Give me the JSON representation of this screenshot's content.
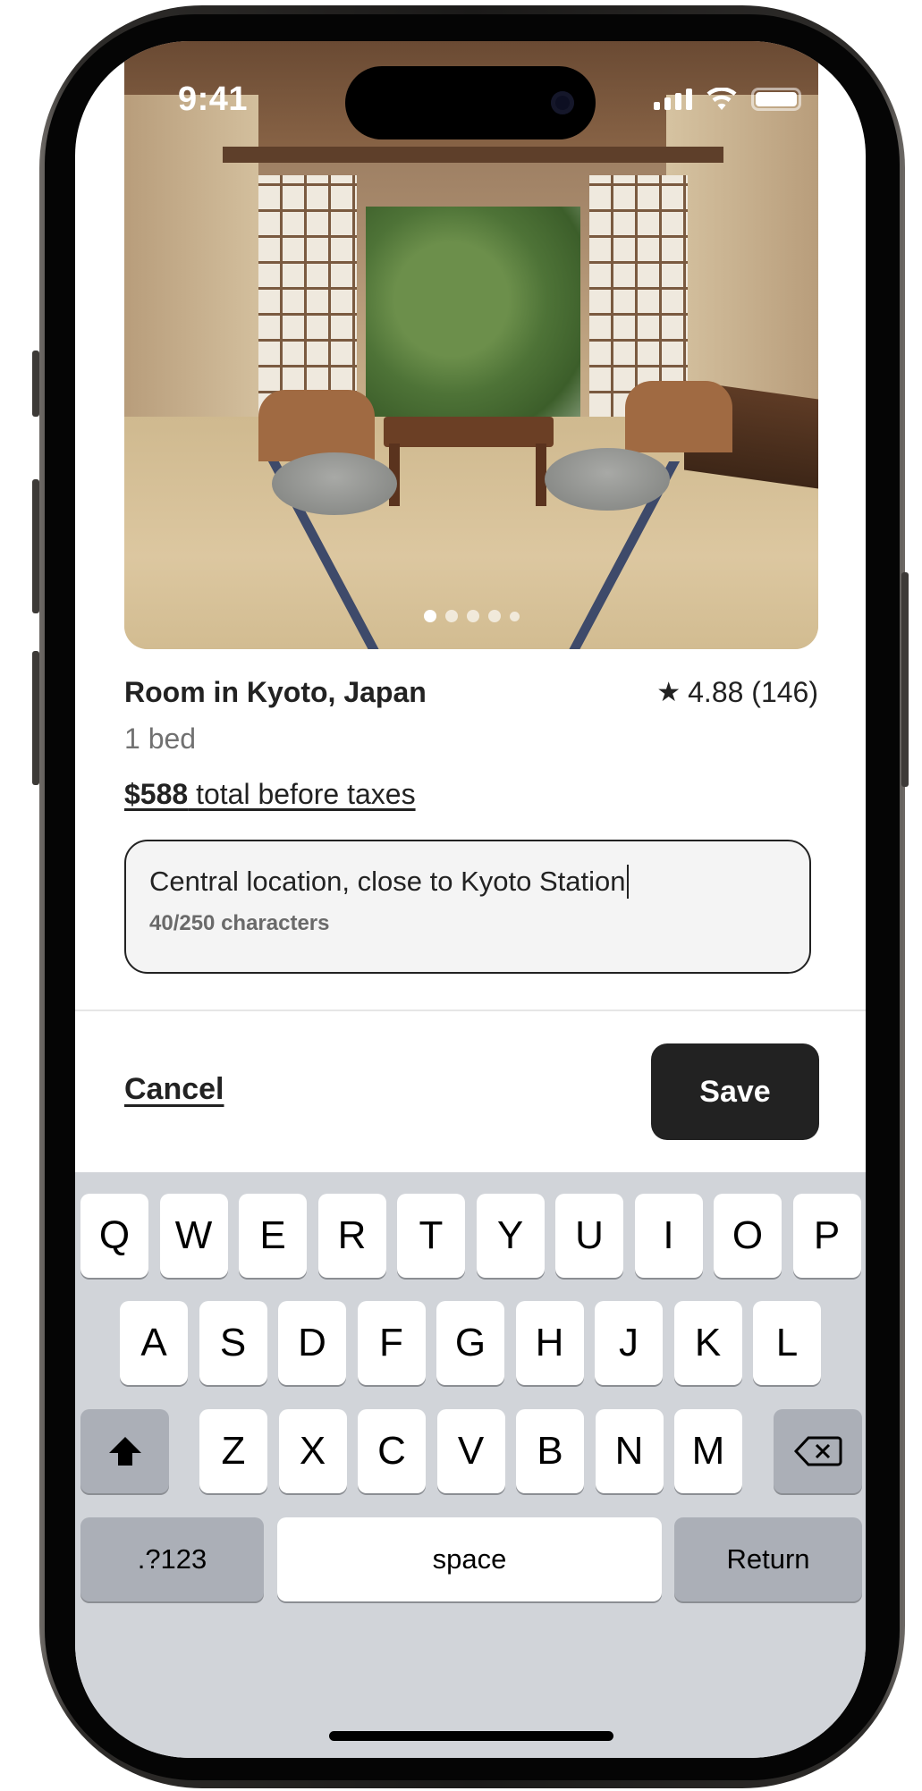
{
  "status_bar": {
    "time": "9:41"
  },
  "listing": {
    "title": "Room in Kyoto, Japan",
    "rating": "4.88 (146)",
    "beds": "1 bed",
    "price_amount": "$588",
    "price_suffix": " total before taxes",
    "photo_count": 5,
    "photo_active_index": 0
  },
  "note": {
    "value": "Central location, close to Kyoto Station",
    "counter": "40/250 characters"
  },
  "actions": {
    "cancel_label": "Cancel",
    "save_label": "Save"
  },
  "keyboard": {
    "row1": [
      "Q",
      "W",
      "E",
      "R",
      "T",
      "Y",
      "U",
      "I",
      "O",
      "P"
    ],
    "row2": [
      "A",
      "S",
      "D",
      "F",
      "G",
      "H",
      "J",
      "K",
      "L"
    ],
    "row3": [
      "Z",
      "X",
      "C",
      "V",
      "B",
      "N",
      "M"
    ],
    "numbers_label": ".?123",
    "space_label": "space",
    "return_label": "Return"
  }
}
